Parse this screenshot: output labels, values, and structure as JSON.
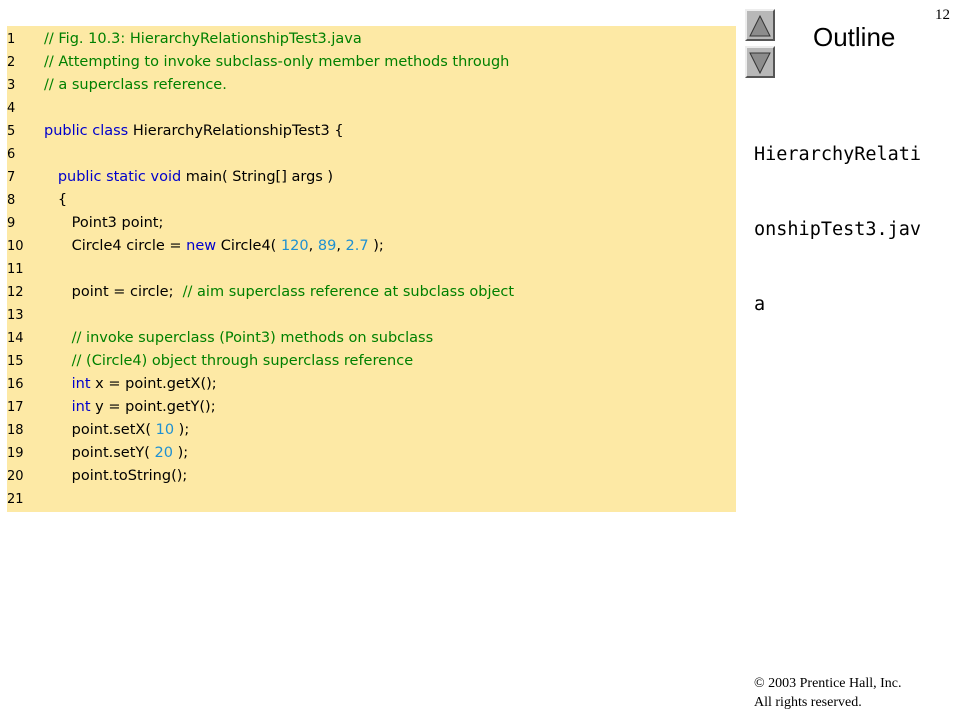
{
  "slide_number": "12",
  "outline": {
    "title": "Outline",
    "file_label_lines": [
      "HierarchyRelati",
      "onshipTest3.jav",
      "a"
    ],
    "up_icon": "triangle-up-icon",
    "down_icon": "triangle-down-icon"
  },
  "copyright": {
    "line1": "© 2003 Prentice Hall, Inc.",
    "line2": "All rights reserved."
  },
  "colors": {
    "panel_bg": "#fde9a5",
    "keyword": "#0000cc",
    "comment": "#008000",
    "number": "#1e90d2"
  },
  "code_lines": [
    {
      "no": "1",
      "tokens": [
        {
          "t": "com",
          "v": "// Fig. 10.3: HierarchyRelationshipTest3.java"
        }
      ]
    },
    {
      "no": "2",
      "tokens": [
        {
          "t": "com",
          "v": "// Attempting to invoke subclass-only member methods through"
        }
      ]
    },
    {
      "no": "3",
      "tokens": [
        {
          "t": "com",
          "v": "// a superclass reference."
        }
      ]
    },
    {
      "no": "4",
      "tokens": []
    },
    {
      "no": "5",
      "tokens": [
        {
          "t": "kw",
          "v": "public class"
        },
        {
          "t": "txt",
          "v": " HierarchyRelationshipTest3 {"
        }
      ]
    },
    {
      "no": "6",
      "tokens": []
    },
    {
      "no": "7",
      "tokens": [
        {
          "t": "txt",
          "v": "   "
        },
        {
          "t": "kw",
          "v": "public static void"
        },
        {
          "t": "txt",
          "v": " main( String[] args )"
        }
      ]
    },
    {
      "no": "8",
      "tokens": [
        {
          "t": "txt",
          "v": "   {"
        }
      ]
    },
    {
      "no": "9",
      "tokens": [
        {
          "t": "txt",
          "v": "      Point3 point;"
        }
      ]
    },
    {
      "no": "10",
      "tokens": [
        {
          "t": "txt",
          "v": "      Circle4 circle = "
        },
        {
          "t": "kw",
          "v": "new"
        },
        {
          "t": "txt",
          "v": " Circle4( "
        },
        {
          "t": "num",
          "v": "120"
        },
        {
          "t": "txt",
          "v": ", "
        },
        {
          "t": "num",
          "v": "89"
        },
        {
          "t": "txt",
          "v": ", "
        },
        {
          "t": "num",
          "v": "2.7"
        },
        {
          "t": "txt",
          "v": " );"
        }
      ]
    },
    {
      "no": "11",
      "tokens": []
    },
    {
      "no": "12",
      "tokens": [
        {
          "t": "txt",
          "v": "      point = circle;  "
        },
        {
          "t": "com",
          "v": "// aim superclass reference at subclass object"
        }
      ]
    },
    {
      "no": "13",
      "tokens": []
    },
    {
      "no": "14",
      "tokens": [
        {
          "t": "txt",
          "v": "      "
        },
        {
          "t": "com",
          "v": "// invoke superclass (Point3) methods on subclass"
        }
      ]
    },
    {
      "no": "15",
      "tokens": [
        {
          "t": "txt",
          "v": "      "
        },
        {
          "t": "com",
          "v": "// (Circle4) object through superclass reference"
        }
      ]
    },
    {
      "no": "16",
      "tokens": [
        {
          "t": "txt",
          "v": "      "
        },
        {
          "t": "kw",
          "v": "int"
        },
        {
          "t": "txt",
          "v": " x = point.getX();"
        }
      ]
    },
    {
      "no": "17",
      "tokens": [
        {
          "t": "txt",
          "v": "      "
        },
        {
          "t": "kw",
          "v": "int"
        },
        {
          "t": "txt",
          "v": " y = point.getY();"
        }
      ]
    },
    {
      "no": "18",
      "tokens": [
        {
          "t": "txt",
          "v": "      point.setX( "
        },
        {
          "t": "num",
          "v": "10"
        },
        {
          "t": "txt",
          "v": " );"
        }
      ]
    },
    {
      "no": "19",
      "tokens": [
        {
          "t": "txt",
          "v": "      point.setY( "
        },
        {
          "t": "num",
          "v": "20"
        },
        {
          "t": "txt",
          "v": " );"
        }
      ]
    },
    {
      "no": "20",
      "tokens": [
        {
          "t": "txt",
          "v": "      point.toString();"
        }
      ]
    },
    {
      "no": "21",
      "tokens": []
    }
  ]
}
